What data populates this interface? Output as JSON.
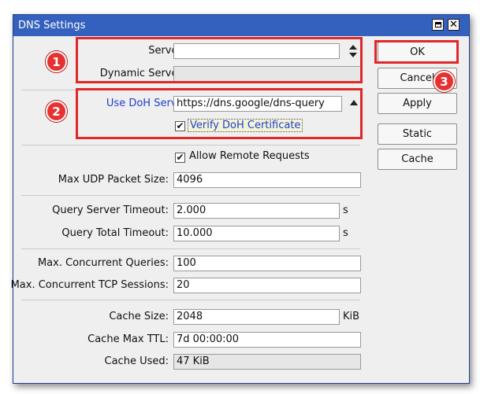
{
  "window": {
    "title": "DNS Settings",
    "close_glyph": "✕"
  },
  "form": {
    "servers": {
      "label": "Servers:",
      "value": ""
    },
    "dynamic_servers": {
      "label": "Dynamic Servers:",
      "value": ""
    },
    "use_doh_server": {
      "label": "Use DoH Server:",
      "value": "https://dns.google/dns-query"
    },
    "verify_doh_certificate": {
      "label": "Verify DoH Certificate",
      "checked": true,
      "check_glyph": "✔"
    },
    "allow_remote_requests": {
      "label": "Allow Remote Requests",
      "checked": true,
      "check_glyph": "✔"
    },
    "max_udp_packet_size": {
      "label": "Max UDP Packet Size:",
      "value": "4096"
    },
    "query_server_timeout": {
      "label": "Query Server Timeout:",
      "value": "2.000",
      "unit": "s"
    },
    "query_total_timeout": {
      "label": "Query Total Timeout:",
      "value": "10.000",
      "unit": "s"
    },
    "max_concurrent_queries": {
      "label": "Max. Concurrent Queries:",
      "value": "100"
    },
    "max_concurrent_tcp_sessions": {
      "label": "Max. Concurrent TCP Sessions:",
      "value": "20"
    },
    "cache_size": {
      "label": "Cache Size:",
      "value": "2048",
      "unit": "KiB"
    },
    "cache_max_ttl": {
      "label": "Cache Max TTL:",
      "value": "7d 00:00:00"
    },
    "cache_used": {
      "label": "Cache Used:",
      "value": "47 KiB"
    }
  },
  "buttons": {
    "ok": "OK",
    "cancel": "Cancel",
    "apply": "Apply",
    "static": "Static",
    "cache": "Cache"
  },
  "annotations": {
    "badge1": "1",
    "badge2": "2",
    "badge3": "3",
    "highlight_color": "#e02828"
  },
  "colors": {
    "titlebar": "#3561be",
    "doh_label": "#1f3fcf"
  }
}
